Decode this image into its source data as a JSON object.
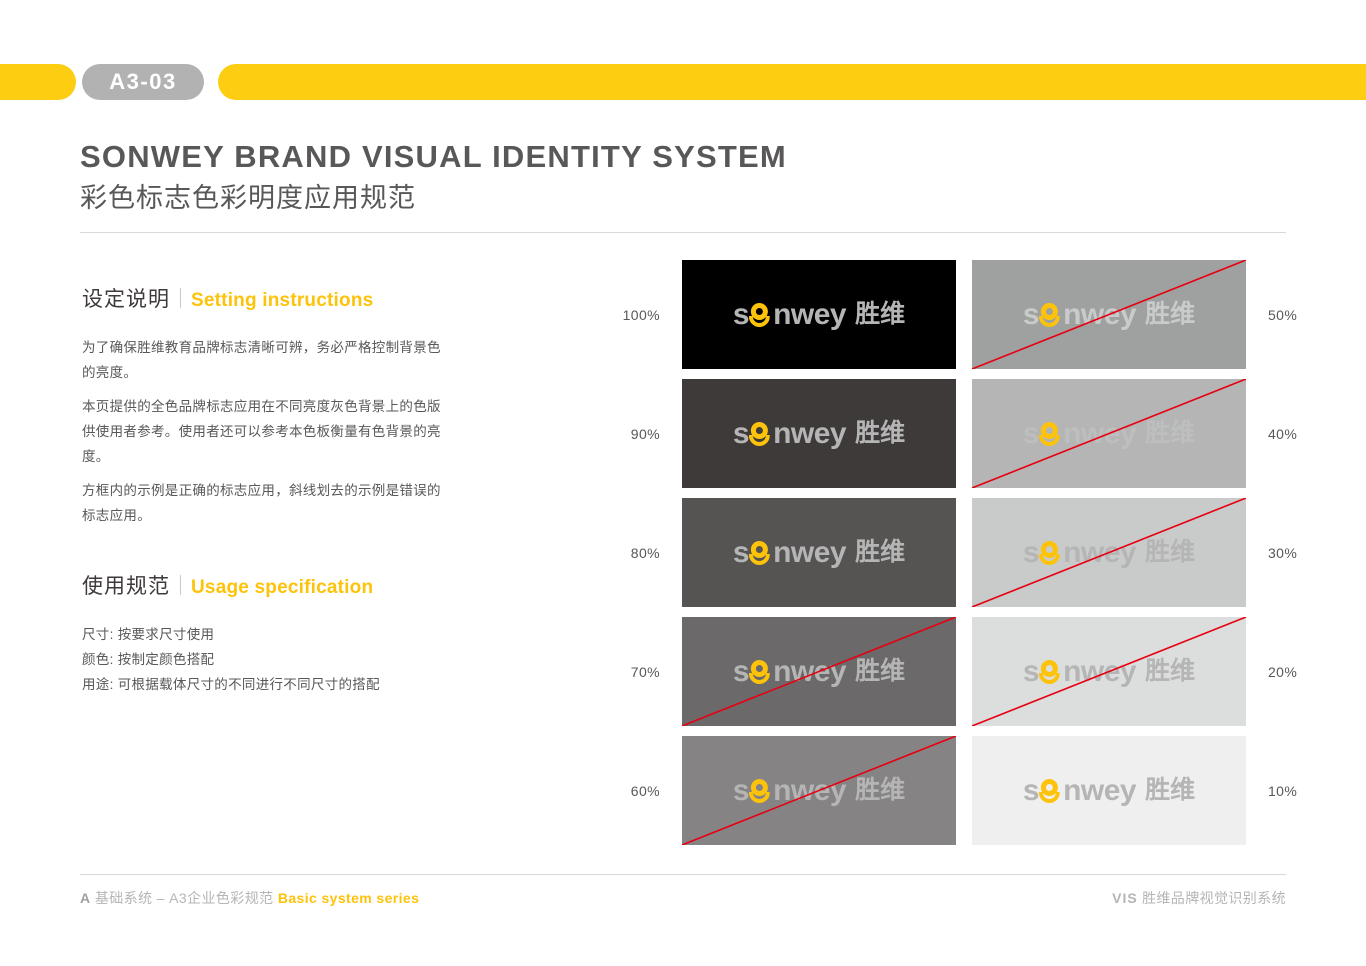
{
  "header": {
    "page_code": "A3-03",
    "bar_color": "#fdcd12",
    "badge_color": "#b2b2b2"
  },
  "title": {
    "english": "SONWEY BRAND VISUAL IDENTITY SYSTEM",
    "chinese": "彩色标志色彩明度应用规范"
  },
  "sections": {
    "setting": {
      "heading_cn": "设定说明",
      "heading_en": "Setting instructions",
      "paragraphs": [
        "为了确保胜维教育品牌标志清晰可辨，务必严格控制背景色的亮度。",
        "本页提供的全色品牌标志应用在不同亮度灰色背景上的色版供使用者参考。使用者还可以参考本色板衡量有色背景的亮度。",
        "方框内的示例是正确的标志应用，斜线划去的示例是错误的标志应用。"
      ]
    },
    "usage": {
      "heading_cn": "使用规范",
      "heading_en": "Usage specification",
      "specs": [
        "尺寸: 按要求尺寸使用",
        "颜色: 按制定颜色搭配",
        "用途: 可根据载体尺寸的不同进行不同尺寸的搭配"
      ]
    }
  },
  "logo": {
    "word_prefix": "s",
    "word_suffix": "nwey",
    "chinese": "胜维",
    "mark_color": "#fdc30a"
  },
  "swatches": {
    "strike_color": "#e60012",
    "rows": [
      {
        "left": {
          "pct": "100%",
          "bg": "#000000",
          "text": "#b5b5b6",
          "strike": false
        },
        "right": {
          "pct": "50%",
          "bg": "#9fa0a0",
          "text": "#c9caca",
          "strike": true
        }
      },
      {
        "left": {
          "pct": "90%",
          "bg": "#3e3a39",
          "text": "#b5b5b6",
          "strike": false
        },
        "right": {
          "pct": "40%",
          "bg": "#b5b5b6",
          "text": "#bdbebe",
          "strike": true
        }
      },
      {
        "left": {
          "pct": "80%",
          "bg": "#565353",
          "text": "#b5b5b6",
          "strike": false
        },
        "right": {
          "pct": "30%",
          "bg": "#c9caca",
          "text": "#b5b5b6",
          "strike": true
        }
      },
      {
        "left": {
          "pct": "70%",
          "bg": "#6b6969",
          "text": "#b5b5b6",
          "strike": true
        },
        "right": {
          "pct": "20%",
          "bg": "#dcdddd",
          "text": "#b5b5b6",
          "strike": true
        }
      },
      {
        "left": {
          "pct": "60%",
          "bg": "#858383",
          "text": "#b5b5b6",
          "strike": true
        },
        "right": {
          "pct": "10%",
          "bg": "#efefef",
          "text": "#b5b5b6",
          "strike": false
        }
      }
    ]
  },
  "footer": {
    "left_code": "A",
    "left_cn": "基础系统 – A3企业色彩规范",
    "left_en": "Basic system series",
    "right_code": "VIS",
    "right_cn": "胜维品牌视觉识别系统"
  }
}
